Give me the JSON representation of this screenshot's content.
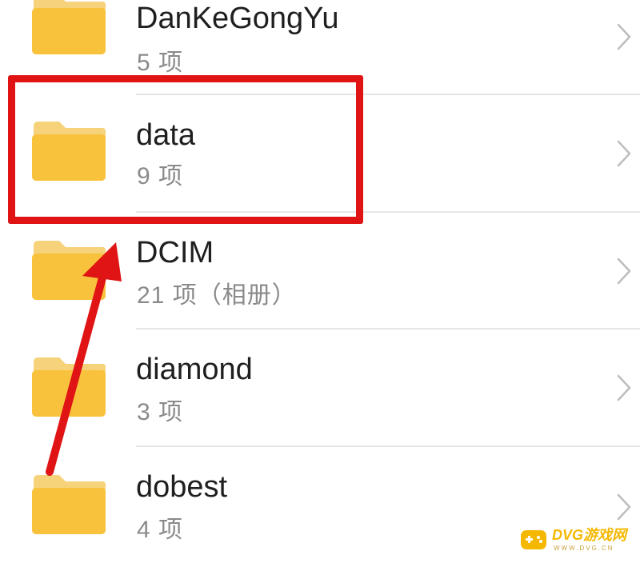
{
  "folders": [
    {
      "name": "DanKeGongYu",
      "count": "5 项"
    },
    {
      "name": "data",
      "count": "9 项"
    },
    {
      "name": "DCIM",
      "count": "21 项（相册）"
    },
    {
      "name": "diamond",
      "count": "3 项"
    },
    {
      "name": "dobest",
      "count": "4 项"
    }
  ],
  "annotation": {
    "highlight_color": "#e01414",
    "highlighted_folder": "data"
  },
  "watermark": {
    "brand": "DVG游戏网",
    "url": "WWW.DVG.CN",
    "color": "#f5b800"
  },
  "icons": {
    "folder": "folder-icon",
    "chevron": "chevron-right-icon"
  },
  "colors": {
    "folder_yellow": "#f9c23c",
    "folder_tab": "#f6d27a",
    "text_primary": "#1f1f1f",
    "text_secondary": "#8a8a8a",
    "divider": "#e6e6e6"
  }
}
